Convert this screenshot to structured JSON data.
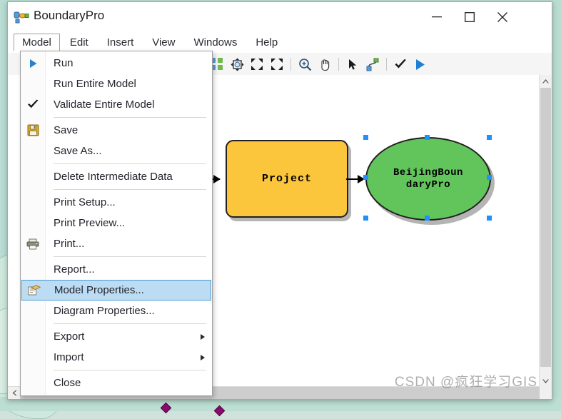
{
  "window": {
    "title": "BoundaryPro",
    "icon": "model-diagram-icon",
    "controls": {
      "minimize": "minimize-button",
      "maximize": "maximize-button",
      "close": "close-button"
    }
  },
  "menubar": {
    "items": [
      {
        "label": "Model",
        "active": true
      },
      {
        "label": "Edit",
        "active": false
      },
      {
        "label": "Insert",
        "active": false
      },
      {
        "label": "View",
        "active": false
      },
      {
        "label": "Windows",
        "active": false
      },
      {
        "label": "Help",
        "active": false
      }
    ]
  },
  "toolbar": {
    "items": [
      {
        "name": "auto-layout-icon",
        "title": "Auto Layout"
      },
      {
        "name": "fit-to-window-icon",
        "title": "Fit To Window"
      },
      {
        "name": "zoom-out-icon",
        "title": "Zoom Out"
      },
      {
        "name": "zoom-in-icon",
        "title": "Zoom In"
      },
      {
        "name": "magnifier-icon",
        "title": "Zoom In Tool"
      },
      {
        "name": "pan-hand-icon",
        "title": "Pan"
      },
      {
        "name": "select-arrow-icon",
        "title": "Select"
      },
      {
        "name": "connect-tool-icon",
        "title": "Connect"
      },
      {
        "name": "validate-check-icon",
        "title": "Validate Entire Model"
      },
      {
        "name": "run-play-icon",
        "title": "Run"
      }
    ]
  },
  "dropdown": {
    "name": "model-menu",
    "items": [
      {
        "label": "Run",
        "icon": "run-play-icon",
        "selected": false,
        "submenu": false,
        "separator_after": false
      },
      {
        "label": "Run Entire Model",
        "icon": "",
        "selected": false,
        "submenu": false,
        "separator_after": false
      },
      {
        "label": "Validate Entire Model",
        "icon": "check-icon",
        "selected": false,
        "submenu": false,
        "separator_after": true
      },
      {
        "label": "Save",
        "icon": "save-floppy-icon",
        "selected": false,
        "submenu": false,
        "separator_after": false
      },
      {
        "label": "Save As...",
        "icon": "",
        "selected": false,
        "submenu": false,
        "separator_after": true
      },
      {
        "label": "Delete Intermediate Data",
        "icon": "",
        "selected": false,
        "submenu": false,
        "separator_after": true
      },
      {
        "label": "Print Setup...",
        "icon": "",
        "selected": false,
        "submenu": false,
        "separator_after": false
      },
      {
        "label": "Print Preview...",
        "icon": "",
        "selected": false,
        "submenu": false,
        "separator_after": false
      },
      {
        "label": "Print...",
        "icon": "printer-icon",
        "selected": false,
        "submenu": false,
        "separator_after": true
      },
      {
        "label": "Report...",
        "icon": "",
        "selected": false,
        "submenu": false,
        "separator_after": false
      },
      {
        "label": "Model Properties...",
        "icon": "model-properties-icon",
        "selected": true,
        "submenu": false,
        "separator_after": false
      },
      {
        "label": "Diagram Properties...",
        "icon": "",
        "selected": false,
        "submenu": false,
        "separator_after": true
      },
      {
        "label": "Export",
        "icon": "",
        "selected": false,
        "submenu": true,
        "separator_after": false
      },
      {
        "label": "Import",
        "icon": "",
        "selected": false,
        "submenu": true,
        "separator_after": true
      },
      {
        "label": "Close",
        "icon": "",
        "selected": false,
        "submenu": false,
        "separator_after": false
      }
    ]
  },
  "canvas": {
    "shapes": [
      {
        "name": "tool-project",
        "label": "Project",
        "type": "rounded-rect",
        "fill": "#FCC63C",
        "selected": false
      },
      {
        "name": "output-beijingboundarypro",
        "label": "BeijingBoun\ndaryPro",
        "type": "ellipse",
        "fill": "#62C55C",
        "selected": true
      }
    ],
    "connectors": [
      {
        "name": "input-connector",
        "from": "canvas-edge",
        "to": "tool-project"
      },
      {
        "name": "output-connector",
        "from": "tool-project",
        "to": "output-beijingboundarypro"
      }
    ],
    "selection_handle_color": "#1E90FF",
    "selection_handle_count": 8
  },
  "scrollbars": {
    "vertical": {
      "name": "vertical-scrollbar",
      "up": "scroll-up-arrow",
      "down": "scroll-down-arrow"
    },
    "horizontal": {
      "name": "horizontal-scrollbar",
      "left": "scroll-left-arrow"
    }
  },
  "watermark": {
    "text": "CSDN @疯狂学习GIS"
  }
}
